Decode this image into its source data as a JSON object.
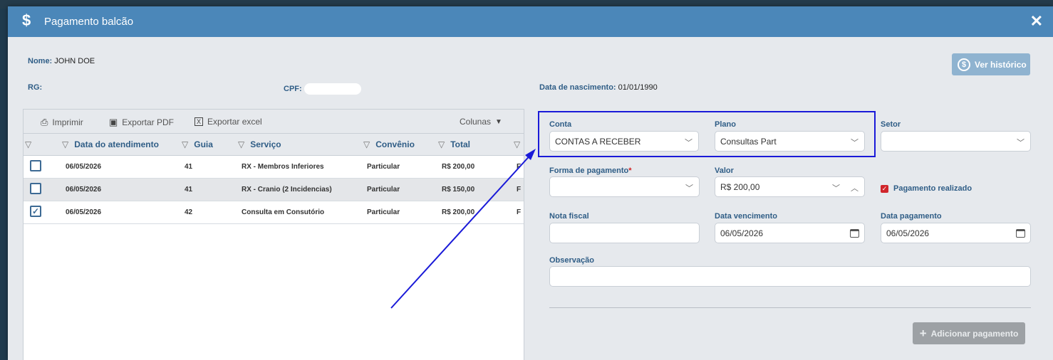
{
  "modal": {
    "title": "Pagamento balcão",
    "icon": "dollar-icon",
    "close": "✕"
  },
  "patient": {
    "nome_label": "Nome:",
    "nome": "JOHN DOE",
    "rg_label": "RG:",
    "rg": "",
    "cpf_label": "CPF:",
    "cpf": "",
    "nasc_label": "Data de nascimento:",
    "nasc": "01/01/1990"
  },
  "history_button": "Ver histórico",
  "toolbar": {
    "print": "Imprimir",
    "pdf": "Exportar PDF",
    "excel": "Exportar excel",
    "columns": "Colunas"
  },
  "table": {
    "columns": [
      "Data do atendimento",
      "Guia",
      "Serviço",
      "Convênio",
      "Total"
    ],
    "rows": [
      {
        "checked": false,
        "date": "06/05/2026",
        "guia": "41",
        "servico": "RX - Membros Inferiores",
        "convenio": "Particular",
        "total": "R$ 200,00"
      },
      {
        "checked": false,
        "date": "06/05/2026",
        "guia": "41",
        "servico": "RX - Cranio (2 Incidencias)",
        "convenio": "Particular",
        "total": "R$ 150,00"
      },
      {
        "checked": true,
        "date": "06/05/2026",
        "guia": "42",
        "servico": "Consulta em Consutório",
        "convenio": "Particular",
        "total": "R$ 200,00"
      }
    ]
  },
  "form": {
    "conta_label": "Conta",
    "conta_value": "CONTAS A RECEBER",
    "plano_label": "Plano",
    "plano_value": "Consultas Part",
    "setor_label": "Setor",
    "setor_value": "",
    "forma_label": "Forma de pagamento",
    "forma_required": "*",
    "forma_value": "",
    "valor_label": "Valor",
    "valor_value": "R$ 200,00",
    "pago_label": "Pagamento realizado",
    "pago_checked": true,
    "nota_label": "Nota fiscal",
    "nota_value": "",
    "venc_label": "Data vencimento",
    "venc_value": "06/05/2026",
    "datapag_label": "Data pagamento",
    "datapag_value": "06/05/2026",
    "obs_label": "Observação",
    "obs_value": ""
  },
  "add_button": "Adicionar pagamento",
  "colors": {
    "header": "#4b87b9",
    "label": "#2f5d86",
    "annotation": "#1a1ad8"
  }
}
